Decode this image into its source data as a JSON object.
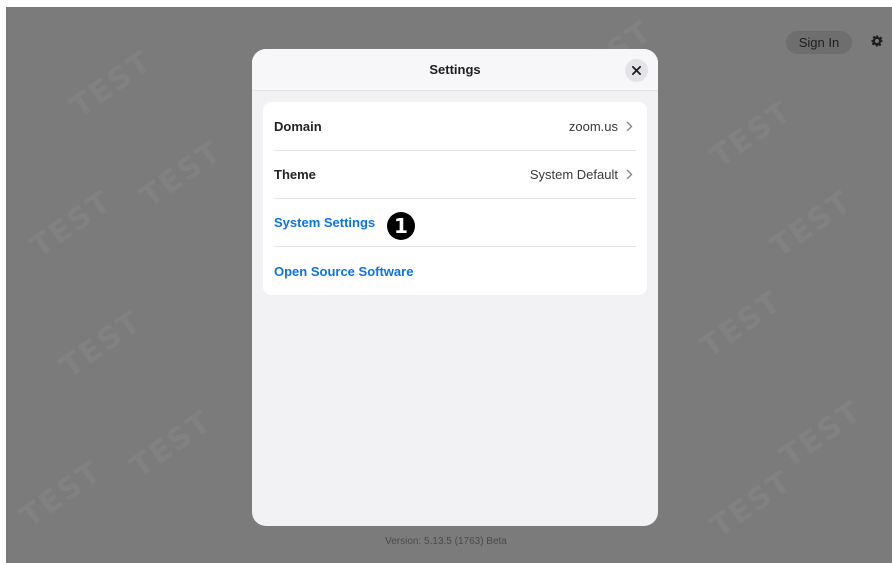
{
  "background": {
    "sign_in_label": "Sign In",
    "version_text": "Version: 5.13.5 (1763) Beta"
  },
  "modal": {
    "title": "Settings",
    "rows": [
      {
        "label": "Domain",
        "value": "zoom.us"
      },
      {
        "label": "Theme",
        "value": "System Default"
      },
      {
        "label": "System Settings"
      },
      {
        "label": "Open Source Software"
      }
    ]
  },
  "annotation": {
    "marker": "1"
  },
  "icons": {
    "close": "close-icon",
    "gear": "gear-icon",
    "chevron": "chevron-right-icon"
  },
  "colors": {
    "accent_link": "#0e72ed",
    "overlay": "#7b7b7b"
  }
}
